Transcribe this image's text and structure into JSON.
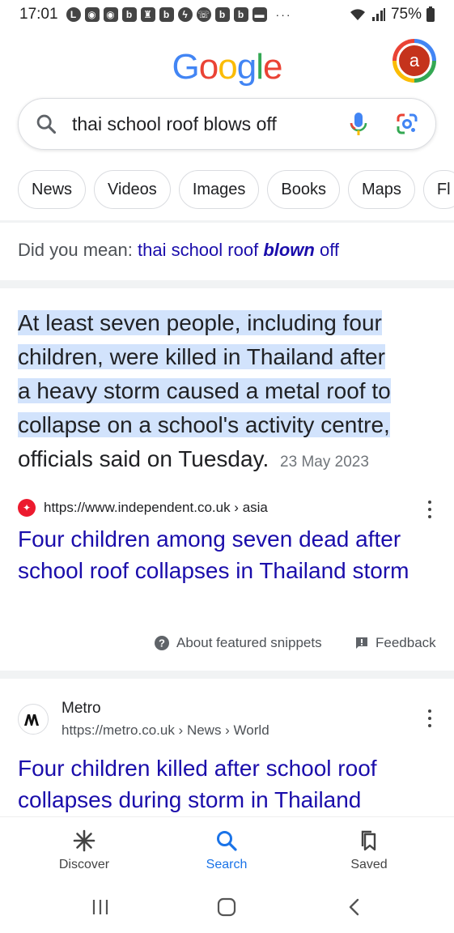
{
  "status_bar": {
    "time": "17:01",
    "battery": "75%",
    "notification_icons": [
      "line-icon",
      "discord-icon",
      "discord-icon",
      "b-icon",
      "castle-icon",
      "b-icon",
      "messenger-icon",
      "whatsapp-icon",
      "b-icon",
      "b-icon",
      "chat-icon"
    ],
    "overflow": "···"
  },
  "header": {
    "logo_letters": [
      {
        "ch": "G",
        "color": "#4285f4"
      },
      {
        "ch": "o",
        "color": "#ea4335"
      },
      {
        "ch": "o",
        "color": "#fbbc05"
      },
      {
        "ch": "g",
        "color": "#4285f4"
      },
      {
        "ch": "l",
        "color": "#34a853"
      },
      {
        "ch": "e",
        "color": "#ea4335"
      }
    ],
    "avatar_letter": "a"
  },
  "search": {
    "query": "thai school roof blows off"
  },
  "chips": [
    "News",
    "Videos",
    "Images",
    "Books",
    "Maps",
    "Fl"
  ],
  "did_you_mean": {
    "prefix": "Did you mean:",
    "suggestion_start": "thai school roof",
    "suggestion_bold": "blown",
    "suggestion_end": "off"
  },
  "featured_snippet": {
    "highlighted_lines": [
      "At least seven people, including four",
      "children, were killed in Thailand after",
      "a heavy storm caused a metal roof to",
      "collapse on a school's activity centre,"
    ],
    "rest": "officials said on Tuesday.",
    "date": "23 May 2023",
    "source_url": "https://www.independent.co.uk › asia",
    "title": "Four children among seven dead after school roof collapses in Thailand storm",
    "about_label": "About featured snippets",
    "feedback_label": "Feedback"
  },
  "result_2": {
    "site_name": "Metro",
    "url": "https://metro.co.uk › News › World",
    "title": "Four children killed after school roof collapses during storm in Thailand"
  },
  "bottom_nav": {
    "discover": "Discover",
    "search": "Search",
    "saved": "Saved"
  },
  "colors": {
    "link": "#1a0dab",
    "active": "#1a73e8",
    "highlight": "#d2e3fc",
    "independent_red": "#ec1a2e"
  }
}
